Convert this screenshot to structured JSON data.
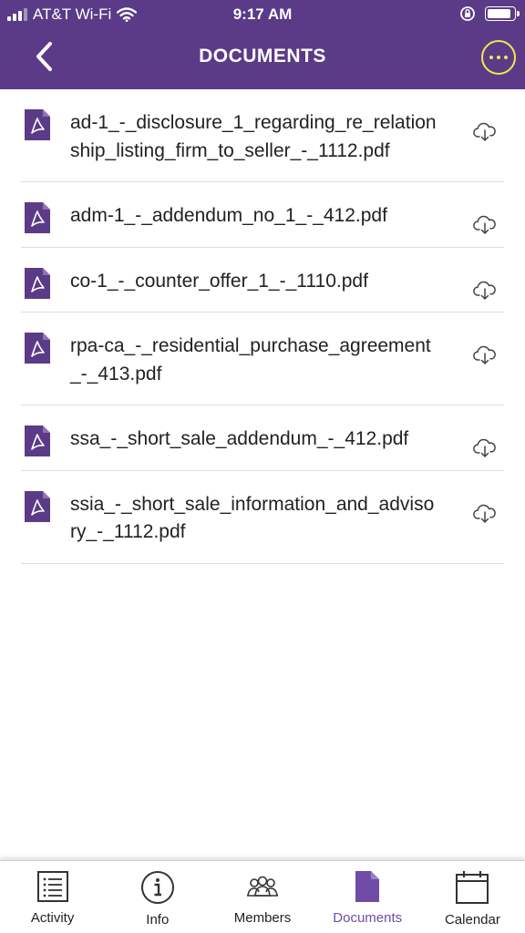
{
  "status_bar": {
    "carrier": "AT&T Wi-Fi",
    "time": "9:17 AM"
  },
  "header": {
    "title": "DOCUMENTS",
    "back_icon": "chevron-left-icon",
    "more_icon": "ellipsis-circle-icon",
    "background_color": "#5b3b87",
    "accent_color": "#f2e84a"
  },
  "documents": [
    {
      "name": "ad-1_-_disclosure_1_regarding_re_relationship_listing_firm_to_seller_-_1112.pdf",
      "icon": "pdf-file-icon",
      "action_icon": "cloud-download-icon"
    },
    {
      "name": "adm-1_-_addendum_no_1_-_412.pdf",
      "icon": "pdf-file-icon",
      "action_icon": "cloud-download-icon"
    },
    {
      "name": "co-1_-_counter_offer_1_-_1110.pdf",
      "icon": "pdf-file-icon",
      "action_icon": "cloud-download-icon"
    },
    {
      "name": "rpa-ca_-_residential_purchase_agreement_-_413.pdf",
      "icon": "pdf-file-icon",
      "action_icon": "cloud-download-icon"
    },
    {
      "name": "ssa_-_short_sale_addendum_-_412.pdf",
      "icon": "pdf-file-icon",
      "action_icon": "cloud-download-icon"
    },
    {
      "name": "ssia_-_short_sale_information_and_advisory_-_1112.pdf",
      "icon": "pdf-file-icon",
      "action_icon": "cloud-download-icon"
    }
  ],
  "tabbar": {
    "active": "Documents",
    "active_color": "#6f4ca8",
    "tabs": [
      {
        "label": "Activity",
        "icon": "list-icon"
      },
      {
        "label": "Info",
        "icon": "info-icon"
      },
      {
        "label": "Members",
        "icon": "members-icon"
      },
      {
        "label": "Documents",
        "icon": "document-icon"
      },
      {
        "label": "Calendar",
        "icon": "calendar-icon"
      }
    ]
  }
}
